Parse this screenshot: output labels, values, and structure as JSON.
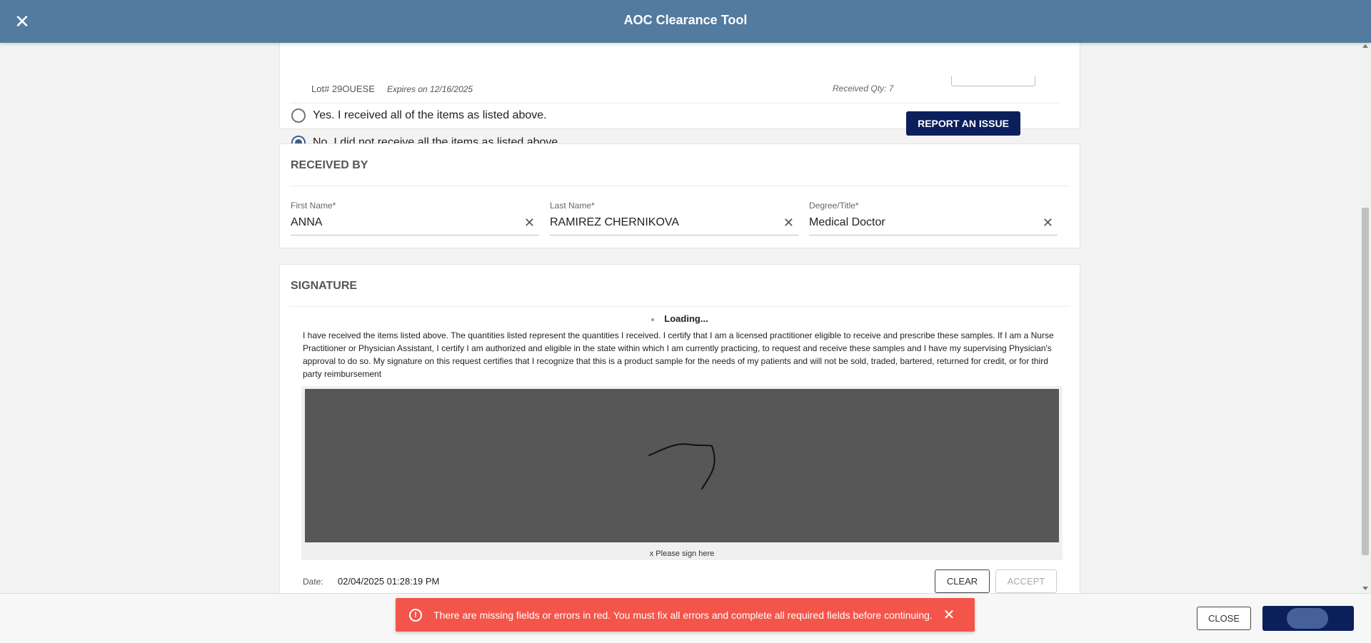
{
  "header": {
    "title": "AOC Clearance Tool",
    "close_icon": "close-icon"
  },
  "item_row": {
    "lot": "Lot# 29OUESE",
    "expires": "Expires on 12/16/2025",
    "received_qty": "Received Qty: 7"
  },
  "confirmation": {
    "option_yes": "Yes. I received all of the items as listed above.",
    "option_no": "No. I did not receive all the items as listed above.",
    "selected": "no",
    "report_button": "REPORT AN ISSUE"
  },
  "received_by": {
    "title": "RECEIVED BY",
    "first_name_label": "First Name*",
    "first_name_value": "ANNA",
    "last_name_label": "Last Name*",
    "last_name_value": "RAMIREZ CHERNIKOVA",
    "degree_label": "Degree/Title*",
    "degree_value": "Medical Doctor"
  },
  "signature": {
    "title": "SIGNATURE",
    "loading": "Loading...",
    "legal_text": "I have received the items listed above. The quantities listed represent the quantities I received. I certify that I am a licensed practitioner eligible to receive and prescribe these samples. If I am a Nurse Practitioner or Physician Assistant, I certify I am authorized and eligible in the state within which I am currently practicing, to request and receive these samples and I have my supervising Physician's approval to do so. My signature on this request certifies that I recognize that this is a product sample for the needs of my patients and will not be sold, traded, bartered, returned for credit, or for third party reimbursement",
    "hint": "x Please sign here",
    "date_label": "Date:",
    "date_value": "02/04/2025 01:28:19 PM",
    "clear_button": "CLEAR",
    "accept_button": "ACCEPT"
  },
  "footer": {
    "close_button": "CLOSE"
  },
  "toast": {
    "message": "There are missing fields or errors in red. You must fix all errors and complete all required fields before continuing.",
    "icon": "alert-circle-icon"
  },
  "colors": {
    "header_bg": "#537a9f",
    "primary_button": "#0a1f5c",
    "error_toast": "#f4554a",
    "signature_pad": "#575757"
  }
}
